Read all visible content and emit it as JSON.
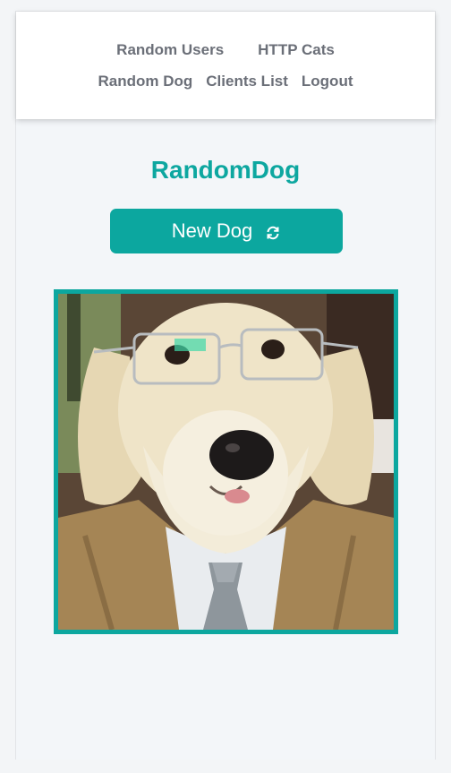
{
  "nav": {
    "row1": [
      "Random Users",
      "HTTP Cats"
    ],
    "row2": [
      "Random Dog",
      "Clients List",
      "Logout"
    ]
  },
  "main": {
    "title": "RandomDog",
    "new_dog_label": "New Dog",
    "refresh_icon": "refresh-icon"
  },
  "colors": {
    "accent": "#0ca79f",
    "nav_text": "#6b6f78",
    "background": "#f3f6f9"
  }
}
